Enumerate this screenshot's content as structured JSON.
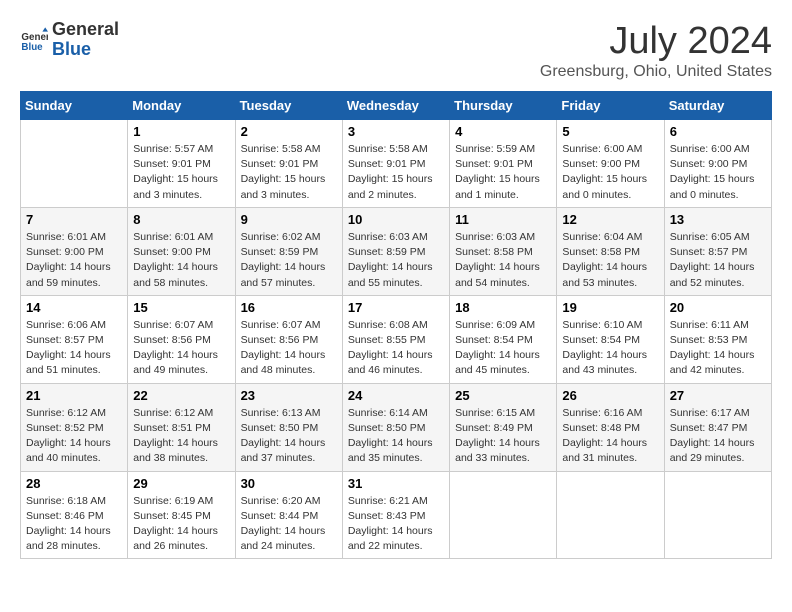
{
  "logo": {
    "general": "General",
    "blue": "Blue"
  },
  "title": "July 2024",
  "location": "Greensburg, Ohio, United States",
  "days_of_week": [
    "Sunday",
    "Monday",
    "Tuesday",
    "Wednesday",
    "Thursday",
    "Friday",
    "Saturday"
  ],
  "weeks": [
    [
      {
        "day": "",
        "info": ""
      },
      {
        "day": "1",
        "info": "Sunrise: 5:57 AM\nSunset: 9:01 PM\nDaylight: 15 hours\nand 3 minutes."
      },
      {
        "day": "2",
        "info": "Sunrise: 5:58 AM\nSunset: 9:01 PM\nDaylight: 15 hours\nand 3 minutes."
      },
      {
        "day": "3",
        "info": "Sunrise: 5:58 AM\nSunset: 9:01 PM\nDaylight: 15 hours\nand 2 minutes."
      },
      {
        "day": "4",
        "info": "Sunrise: 5:59 AM\nSunset: 9:01 PM\nDaylight: 15 hours\nand 1 minute."
      },
      {
        "day": "5",
        "info": "Sunrise: 6:00 AM\nSunset: 9:00 PM\nDaylight: 15 hours\nand 0 minutes."
      },
      {
        "day": "6",
        "info": "Sunrise: 6:00 AM\nSunset: 9:00 PM\nDaylight: 15 hours\nand 0 minutes."
      }
    ],
    [
      {
        "day": "7",
        "info": "Sunrise: 6:01 AM\nSunset: 9:00 PM\nDaylight: 14 hours\nand 59 minutes."
      },
      {
        "day": "8",
        "info": "Sunrise: 6:01 AM\nSunset: 9:00 PM\nDaylight: 14 hours\nand 58 minutes."
      },
      {
        "day": "9",
        "info": "Sunrise: 6:02 AM\nSunset: 8:59 PM\nDaylight: 14 hours\nand 57 minutes."
      },
      {
        "day": "10",
        "info": "Sunrise: 6:03 AM\nSunset: 8:59 PM\nDaylight: 14 hours\nand 55 minutes."
      },
      {
        "day": "11",
        "info": "Sunrise: 6:03 AM\nSunset: 8:58 PM\nDaylight: 14 hours\nand 54 minutes."
      },
      {
        "day": "12",
        "info": "Sunrise: 6:04 AM\nSunset: 8:58 PM\nDaylight: 14 hours\nand 53 minutes."
      },
      {
        "day": "13",
        "info": "Sunrise: 6:05 AM\nSunset: 8:57 PM\nDaylight: 14 hours\nand 52 minutes."
      }
    ],
    [
      {
        "day": "14",
        "info": "Sunrise: 6:06 AM\nSunset: 8:57 PM\nDaylight: 14 hours\nand 51 minutes."
      },
      {
        "day": "15",
        "info": "Sunrise: 6:07 AM\nSunset: 8:56 PM\nDaylight: 14 hours\nand 49 minutes."
      },
      {
        "day": "16",
        "info": "Sunrise: 6:07 AM\nSunset: 8:56 PM\nDaylight: 14 hours\nand 48 minutes."
      },
      {
        "day": "17",
        "info": "Sunrise: 6:08 AM\nSunset: 8:55 PM\nDaylight: 14 hours\nand 46 minutes."
      },
      {
        "day": "18",
        "info": "Sunrise: 6:09 AM\nSunset: 8:54 PM\nDaylight: 14 hours\nand 45 minutes."
      },
      {
        "day": "19",
        "info": "Sunrise: 6:10 AM\nSunset: 8:54 PM\nDaylight: 14 hours\nand 43 minutes."
      },
      {
        "day": "20",
        "info": "Sunrise: 6:11 AM\nSunset: 8:53 PM\nDaylight: 14 hours\nand 42 minutes."
      }
    ],
    [
      {
        "day": "21",
        "info": "Sunrise: 6:12 AM\nSunset: 8:52 PM\nDaylight: 14 hours\nand 40 minutes."
      },
      {
        "day": "22",
        "info": "Sunrise: 6:12 AM\nSunset: 8:51 PM\nDaylight: 14 hours\nand 38 minutes."
      },
      {
        "day": "23",
        "info": "Sunrise: 6:13 AM\nSunset: 8:50 PM\nDaylight: 14 hours\nand 37 minutes."
      },
      {
        "day": "24",
        "info": "Sunrise: 6:14 AM\nSunset: 8:50 PM\nDaylight: 14 hours\nand 35 minutes."
      },
      {
        "day": "25",
        "info": "Sunrise: 6:15 AM\nSunset: 8:49 PM\nDaylight: 14 hours\nand 33 minutes."
      },
      {
        "day": "26",
        "info": "Sunrise: 6:16 AM\nSunset: 8:48 PM\nDaylight: 14 hours\nand 31 minutes."
      },
      {
        "day": "27",
        "info": "Sunrise: 6:17 AM\nSunset: 8:47 PM\nDaylight: 14 hours\nand 29 minutes."
      }
    ],
    [
      {
        "day": "28",
        "info": "Sunrise: 6:18 AM\nSunset: 8:46 PM\nDaylight: 14 hours\nand 28 minutes."
      },
      {
        "day": "29",
        "info": "Sunrise: 6:19 AM\nSunset: 8:45 PM\nDaylight: 14 hours\nand 26 minutes."
      },
      {
        "day": "30",
        "info": "Sunrise: 6:20 AM\nSunset: 8:44 PM\nDaylight: 14 hours\nand 24 minutes."
      },
      {
        "day": "31",
        "info": "Sunrise: 6:21 AM\nSunset: 8:43 PM\nDaylight: 14 hours\nand 22 minutes."
      },
      {
        "day": "",
        "info": ""
      },
      {
        "day": "",
        "info": ""
      },
      {
        "day": "",
        "info": ""
      }
    ]
  ]
}
